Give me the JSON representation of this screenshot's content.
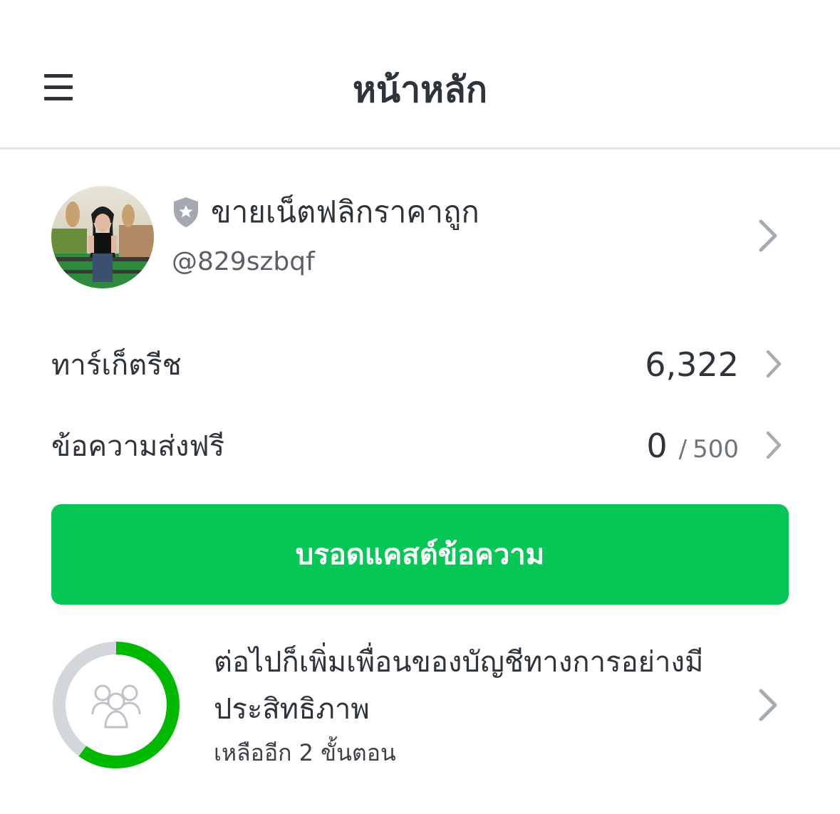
{
  "header": {
    "title": "หน้าหลัก",
    "menu_icon": "hamburger-menu-icon"
  },
  "profile": {
    "name": "ขายเน็ตฟลิกราคาถูก",
    "account_id": "@829szbqf",
    "badge_icon": "shield-star-icon"
  },
  "stats": {
    "target_reach_label": "ทาร์เก็ตรีช",
    "target_reach_value": "6,322",
    "free_messages_label": "ข้อความส่งฟรี",
    "free_messages_used": "0",
    "free_messages_separator": "/",
    "free_messages_quota": "500"
  },
  "broadcast": {
    "label": "บรอดแคสต์ข้อความ"
  },
  "setup_progress": {
    "title": "ต่อไปก็เพิ่มเพื่อนของบัญชีทางการอย่างมีประสิทธิภาพ",
    "subtitle": "เหลืออีก 2 ขั้นตอน",
    "progress_fraction": 0.6,
    "icon": "friends-group-icon"
  },
  "colors": {
    "accent_green": "#06c755",
    "ring_green": "#00b900",
    "ring_track": "#d3d6da",
    "text_primary": "#2f333a",
    "chevron": "#a7acb3"
  }
}
